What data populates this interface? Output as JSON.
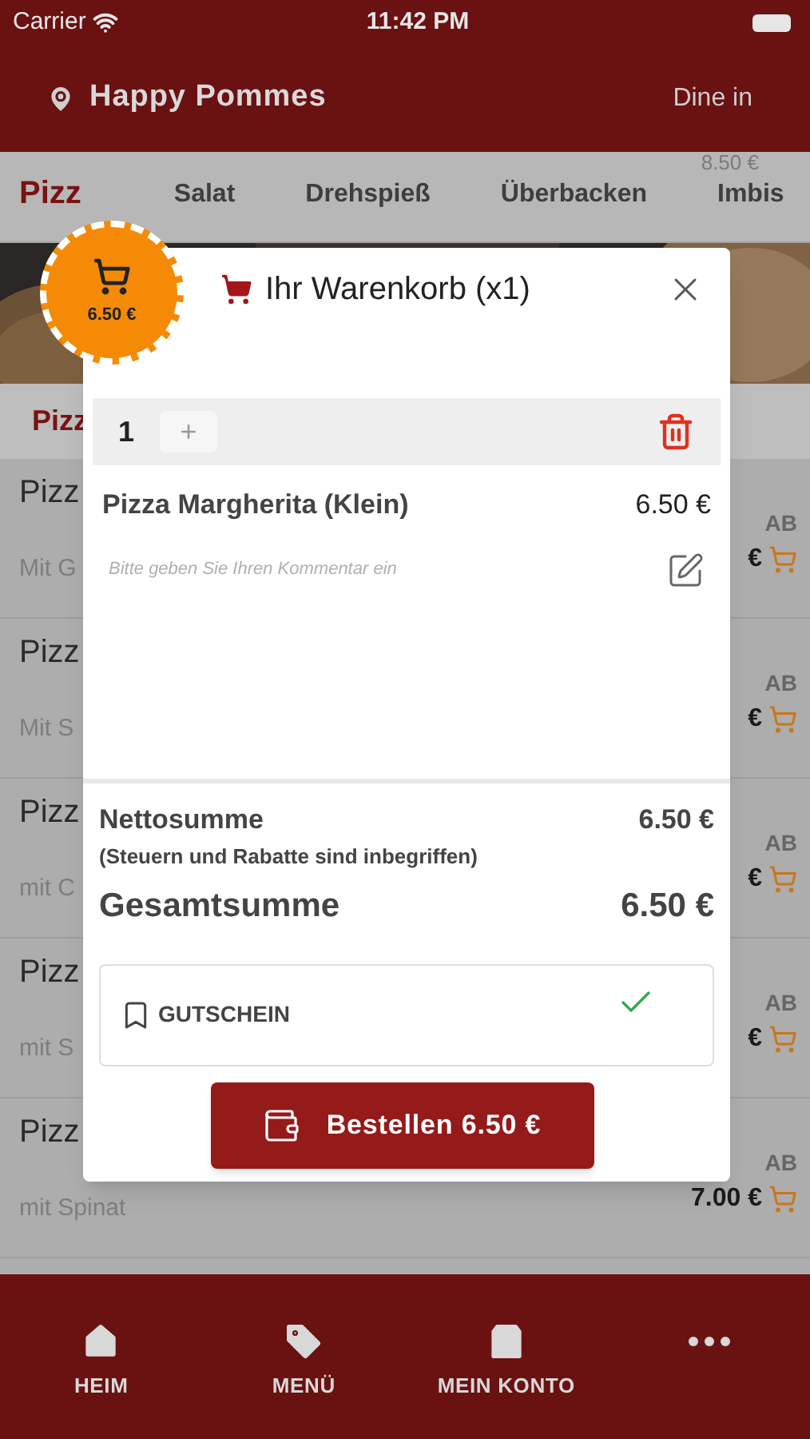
{
  "status_bar": {
    "carrier": "Carrier",
    "time": "11:42 PM"
  },
  "header": {
    "restaurant": "Happy Pommes",
    "mode": "Dine in"
  },
  "category_tabs": [
    {
      "label": "Pizz",
      "selected": true
    },
    {
      "label": "Salat",
      "selected": false
    },
    {
      "label": "Drehspieß",
      "selected": false
    },
    {
      "label": "Überbacken",
      "selected": false
    },
    {
      "label": "Imbis",
      "selected": false
    }
  ],
  "faded_price": "8.50 €",
  "section_title": "Pizz",
  "menu_items": [
    {
      "name": "Pizz",
      "description": "Mit G",
      "prefix": "AB",
      "price": "€"
    },
    {
      "name": "Pizz",
      "description": "Mit S",
      "prefix": "AB",
      "price": "€"
    },
    {
      "name": "Pizz",
      "description": "mit C",
      "prefix": "AB",
      "price": "€"
    },
    {
      "name": "Pizz",
      "description": "mit S",
      "prefix": "AB",
      "price": "€"
    },
    {
      "name": "Pizz",
      "description": "mit Spinat",
      "prefix": "AB",
      "price": "7.00 €"
    }
  ],
  "cart_badge": {
    "total": "6.50 €"
  },
  "cart": {
    "title": "Ihr Warenkorb (x1)",
    "lines": [
      {
        "quantity": "1",
        "plus": "+",
        "name": "Pizza Margherita (Klein)",
        "price": "6.50 €",
        "comment_placeholder": "Bitte geben Sie Ihren Kommentar ein"
      }
    ],
    "net_label": "Nettosumme",
    "net_value": "6.50 €",
    "tax_note": "(Steuern und Rabatte sind inbegriffen)",
    "total_label": "Gesamtsumme",
    "total_value": "6.50 €",
    "voucher": {
      "label": "GUTSCHEIN",
      "applied": true
    },
    "order_button": "Bestellen 6.50 €"
  },
  "bottom_nav": [
    {
      "kind": "home",
      "label": "HEIM"
    },
    {
      "kind": "tag",
      "label": "MENÜ"
    },
    {
      "kind": "bag",
      "label": "MEIN KONTO"
    },
    {
      "kind": "more"
    }
  ]
}
